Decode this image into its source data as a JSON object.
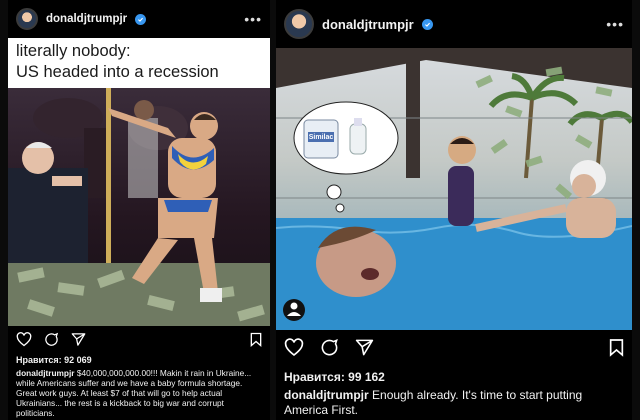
{
  "left_post": {
    "username": "donaldjtrumpjr",
    "meme_top_text": "literally nobody:",
    "meme_bottom_text": "US headed into a recession",
    "likes": "Нравится: 92 069",
    "caption_user": "donaldjtrumpjr",
    "caption_text": "$40,000,000,000.00!!! Makin it rain in Ukraine... while Americans suffer and we have a baby formula shortage. Great work guys. At least $7 of that will go to help actual Ukrainians... the rest is a kickback to big war and corrupt politicians."
  },
  "right_post": {
    "username": "donaldjtrumpjr",
    "formula_label": "Similac",
    "likes": "Нравится: 99 162",
    "caption_user": "donaldjtrumpjr",
    "caption_text": "Enough already. It's time to start putting America First."
  },
  "icons": [
    "heart-icon",
    "comment-icon",
    "share-icon",
    "bookmark-icon",
    "more-icon",
    "verified-badge-icon",
    "user-tag-icon"
  ],
  "colors": {
    "background": "#000000",
    "verified": "#3897f0",
    "text": "#f2f2f2"
  }
}
